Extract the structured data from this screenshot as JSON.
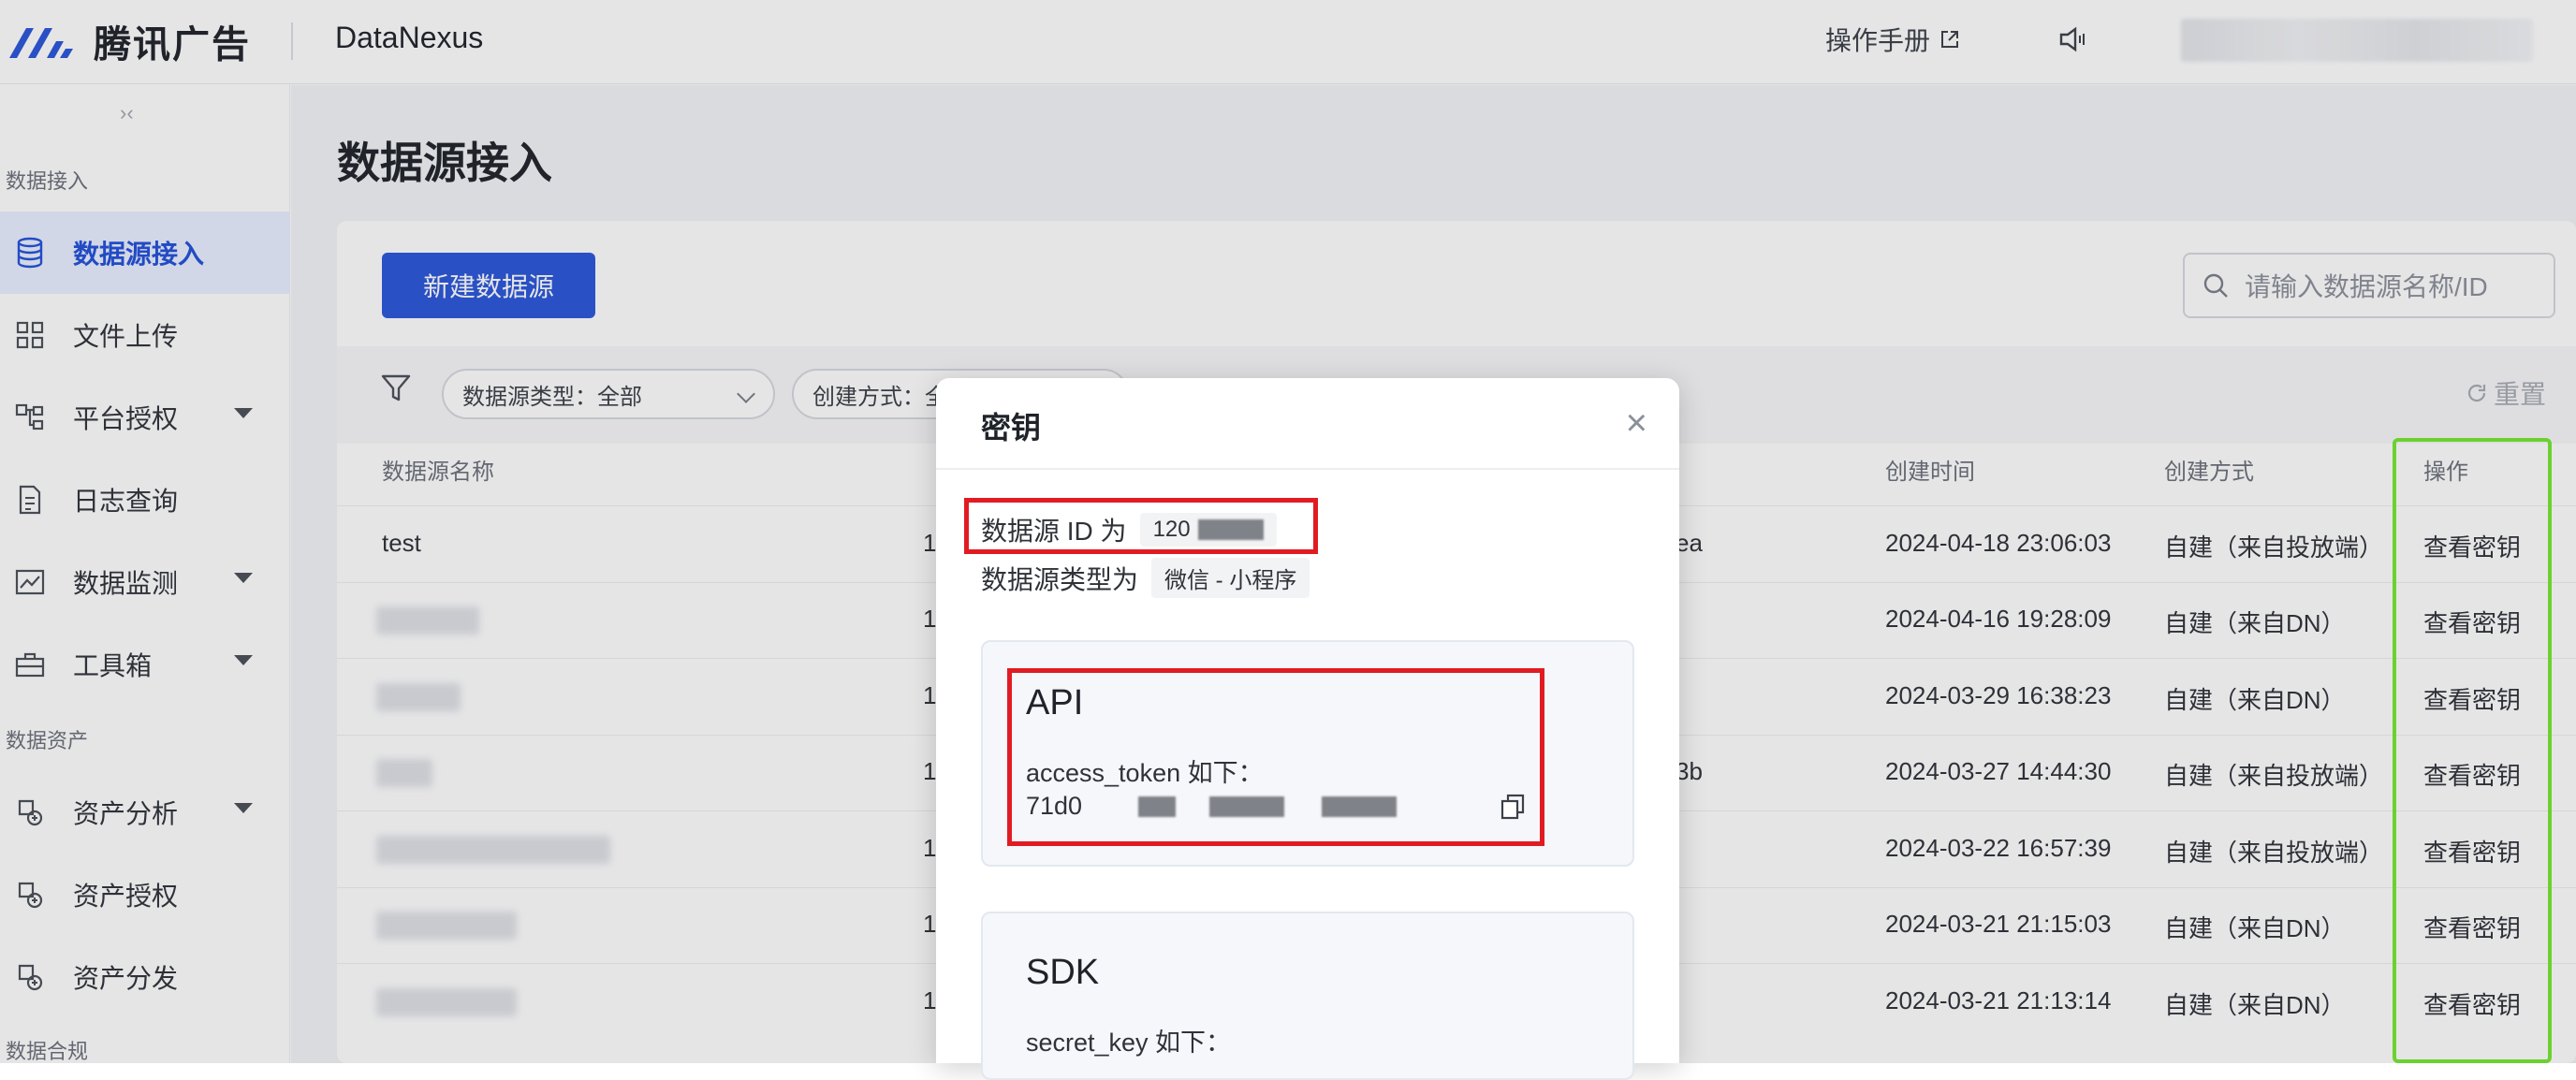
{
  "topbar": {
    "brand": "腾讯广告",
    "product": "DataNexus",
    "manual": "操作手册"
  },
  "sidebar": {
    "collapse_glyph": "›‹",
    "groups": [
      {
        "title": "数据接入"
      },
      {
        "title": "数据资产"
      },
      {
        "title": "数据合规"
      }
    ],
    "items": [
      {
        "label": "数据源接入",
        "icon": "database-icon",
        "active": true
      },
      {
        "label": "文件上传",
        "icon": "grid-icon"
      },
      {
        "label": "平台授权",
        "icon": "org-icon",
        "expandable": true
      },
      {
        "label": "日志查询",
        "icon": "document-icon"
      },
      {
        "label": "数据监测",
        "icon": "chart-icon",
        "expandable": true
      },
      {
        "label": "工具箱",
        "icon": "toolbox-icon",
        "expandable": true
      },
      {
        "label": "资产分析",
        "icon": "asset-icon",
        "expandable": true
      },
      {
        "label": "资产授权",
        "icon": "asset-icon"
      },
      {
        "label": "资产分发",
        "icon": "asset-icon"
      }
    ]
  },
  "main": {
    "title": "数据源接入",
    "new_button": "新建数据源",
    "search_placeholder": "请输入数据源名称/ID",
    "filters": [
      {
        "label": "数据源类型：全部"
      },
      {
        "label": "创建方式：全"
      }
    ],
    "reset": "重置",
    "columns": [
      "数据源名称",
      "创建时间",
      "创建方式",
      "操作"
    ],
    "rows": [
      {
        "name": "test",
        "name_visible": true,
        "id_prefix": "1",
        "extra": "ea",
        "created": "2024-04-18 23:06:03",
        "method": "自建（来自投放端）",
        "action": "查看密钥"
      },
      {
        "name": "",
        "name_visible": false,
        "id_prefix": "1",
        "extra": "",
        "created": "2024-04-16 19:28:09",
        "method": "自建（来自DN）",
        "action": "查看密钥"
      },
      {
        "name": "",
        "name_visible": false,
        "id_prefix": "1",
        "extra": "",
        "created": "2024-03-29 16:38:23",
        "method": "自建（来自DN）",
        "action": "查看密钥"
      },
      {
        "name": "",
        "name_visible": false,
        "id_prefix": "1",
        "extra": "3b",
        "created": "2024-03-27 14:44:30",
        "method": "自建（来自投放端）",
        "action": "查看密钥"
      },
      {
        "name": "",
        "name_visible": false,
        "id_prefix": "1",
        "extra": "",
        "created": "2024-03-22 16:57:39",
        "method": "自建（来自投放端）",
        "action": "查看密钥"
      },
      {
        "name": "",
        "name_visible": false,
        "id_prefix": "1",
        "extra": "",
        "created": "2024-03-21 21:15:03",
        "method": "自建（来自DN）",
        "action": "查看密钥"
      },
      {
        "name": "",
        "name_visible": false,
        "id_prefix": "1",
        "extra": "",
        "created": "2024-03-21 21:13:14",
        "method": "自建（来自DN）",
        "action": "查看密钥"
      }
    ]
  },
  "modal": {
    "title": "密钥",
    "close": "×",
    "id_label": "数据源 ID 为",
    "id_value": "120",
    "type_label": "数据源类型为",
    "type_value": "微信 - 小程序",
    "api": {
      "title": "API",
      "label": "access_token 如下：",
      "token_prefix": "71d0"
    },
    "sdk": {
      "title": "SDK",
      "label": "secret_key 如下："
    }
  },
  "colors": {
    "primary": "#2a56d9",
    "highlight_red": "#e11b22",
    "highlight_green": "#6bd12e"
  }
}
